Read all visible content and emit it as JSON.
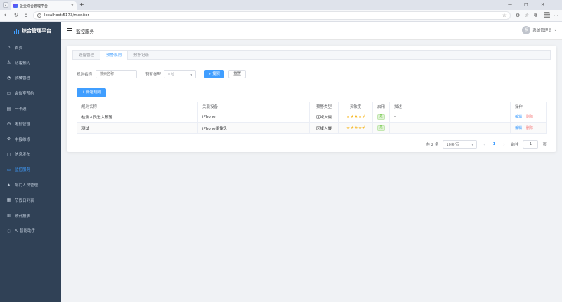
{
  "browser": {
    "tab_title": "企业综合管理平台",
    "tab_close": "×",
    "new_tab": "+",
    "url": "localhost:5173/monitor",
    "icons": [
      "tab-list-icon",
      "back-icon",
      "forward-icon",
      "refresh-icon",
      "home-icon",
      "info-icon",
      "star-icon",
      "extensions-icon",
      "favorites-icon",
      "collections-icon",
      "more-icon"
    ],
    "window_controls": [
      "—",
      "□",
      "✕"
    ]
  },
  "sidebar": {
    "brand_title": "综合管理平台",
    "items": [
      {
        "label": "首页",
        "icon": "home-icon"
      },
      {
        "label": "访客预约",
        "icon": "user-icon"
      },
      {
        "label": "就餐管理",
        "icon": "dining-icon"
      },
      {
        "label": "会议室预约",
        "icon": "meeting-room-icon"
      },
      {
        "label": "一卡通",
        "icon": "card-icon"
      },
      {
        "label": "考勤管理",
        "icon": "clock-icon"
      },
      {
        "label": "申报维修",
        "icon": "repair-icon"
      },
      {
        "label": "信息发布",
        "icon": "notice-icon"
      },
      {
        "label": "监控服务",
        "icon": "monitor-icon",
        "active": true
      },
      {
        "label": "部门人员管理",
        "icon": "people-icon"
      },
      {
        "label": "节假日列表",
        "icon": "calendar-icon"
      },
      {
        "label": "统计报表",
        "icon": "report-icon"
      },
      {
        "label": "AI 智能助手",
        "icon": "chat-icon"
      }
    ]
  },
  "header": {
    "title": "监控服务",
    "avatar_text": "系",
    "username": "系统管理员"
  },
  "tabs": [
    {
      "label": "设备管理",
      "active": false
    },
    {
      "label": "预警规则",
      "active": true
    },
    {
      "label": "预警记录",
      "active": false
    }
  ],
  "filter": {
    "rule_name_label": "规则名称",
    "rule_name_placeholder": "搜索名称",
    "type_label": "预警类型",
    "type_value": "全部",
    "search_button": "搜索",
    "reset_button": "重置"
  },
  "add_button": "+ 新增规则",
  "table": {
    "columns": [
      "规则名称",
      "关联设备",
      "预警类型",
      "灵敏度",
      "启用",
      "描述",
      "操作"
    ],
    "rows": [
      {
        "name": "检测人员进入预警",
        "device": "iPhone",
        "type": "区域入侵",
        "sensitivity_stars": 4.5,
        "sensitivity_display": "★★★★⯨",
        "enabled_label": "是",
        "description": "-",
        "edit": "编辑",
        "delete": "删除"
      },
      {
        "name": "测试",
        "device": "iPhone摄像头",
        "type": "区域入侵",
        "sensitivity_stars": 4.5,
        "sensitivity_display": "★★★★⯨",
        "enabled_label": "是",
        "description": "-",
        "edit": "编辑",
        "delete": "删除"
      }
    ]
  },
  "pagination": {
    "total": "共 2 条",
    "page_size": "10条/页",
    "prev": "‹",
    "current_page": "1",
    "next": "›",
    "goto_label": "前往",
    "goto_value": "1",
    "page_suffix": "页"
  },
  "colors": {
    "sidebar_bg": "#304156",
    "accent": "#409eff",
    "danger": "#f56c6c",
    "star": "#f7ba2a",
    "success": "#67c23a"
  }
}
